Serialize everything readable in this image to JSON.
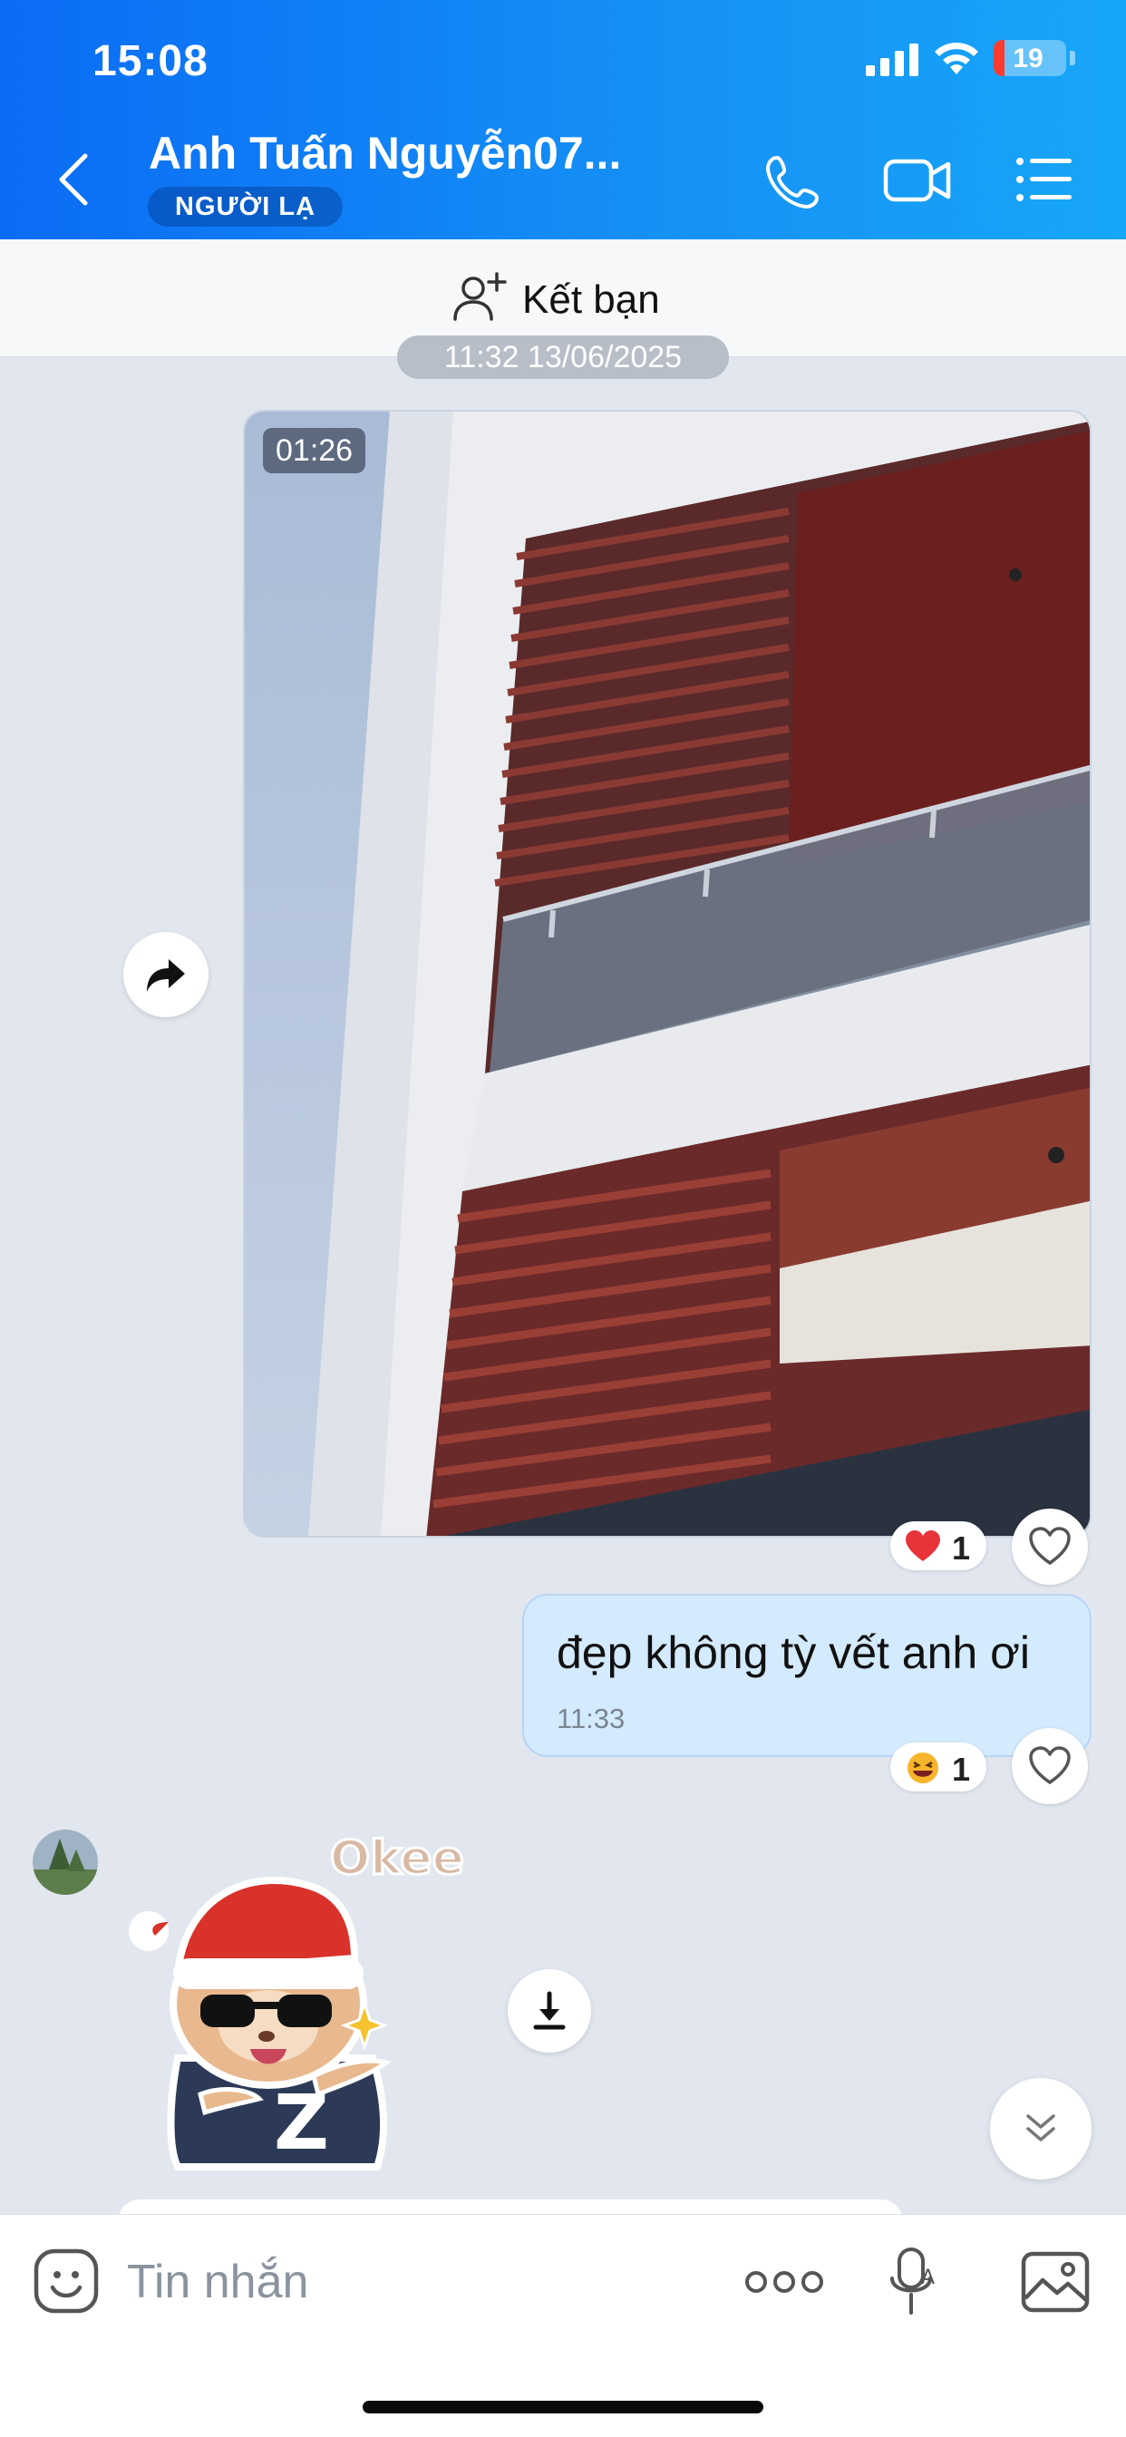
{
  "status_bar": {
    "time": "15:08",
    "battery": "19",
    "icons": [
      "cellular-signal-icon",
      "wifi-icon",
      "battery-icon"
    ]
  },
  "header": {
    "contact_name": "Anh Tuấn Nguyễn07...",
    "badge": "NGƯỜI LẠ",
    "icons": [
      "back-arrow-icon",
      "phone-call-icon",
      "video-call-icon",
      "menu-list-icon"
    ]
  },
  "add_friend": {
    "label": "Kết bạn",
    "icon": "add-person-icon"
  },
  "messages": {
    "date_separator": "11:32 13/06/2025",
    "video": {
      "duration": "01:26",
      "reaction": {
        "emoji": "red-heart",
        "count": "1"
      }
    },
    "text": {
      "body": "đẹp không tỳ vết anh ơi",
      "time": "11:33",
      "reaction": {
        "emoji": "laughing-face",
        "count": "1"
      }
    },
    "sticker": {
      "caption": "Okee",
      "shirt_letter": "Z"
    }
  },
  "composer": {
    "placeholder": "Tin nhắn",
    "icons": [
      "emoji-icon",
      "more-dots-icon",
      "voice-message-icon",
      "image-icon"
    ]
  },
  "colors": {
    "header_start": "#0b6cf5",
    "header_end": "#17a6f7",
    "chat_background": "#e2e7ef",
    "outgoing_bubble": "#d4eafe",
    "heart_red": "#e8333a"
  }
}
